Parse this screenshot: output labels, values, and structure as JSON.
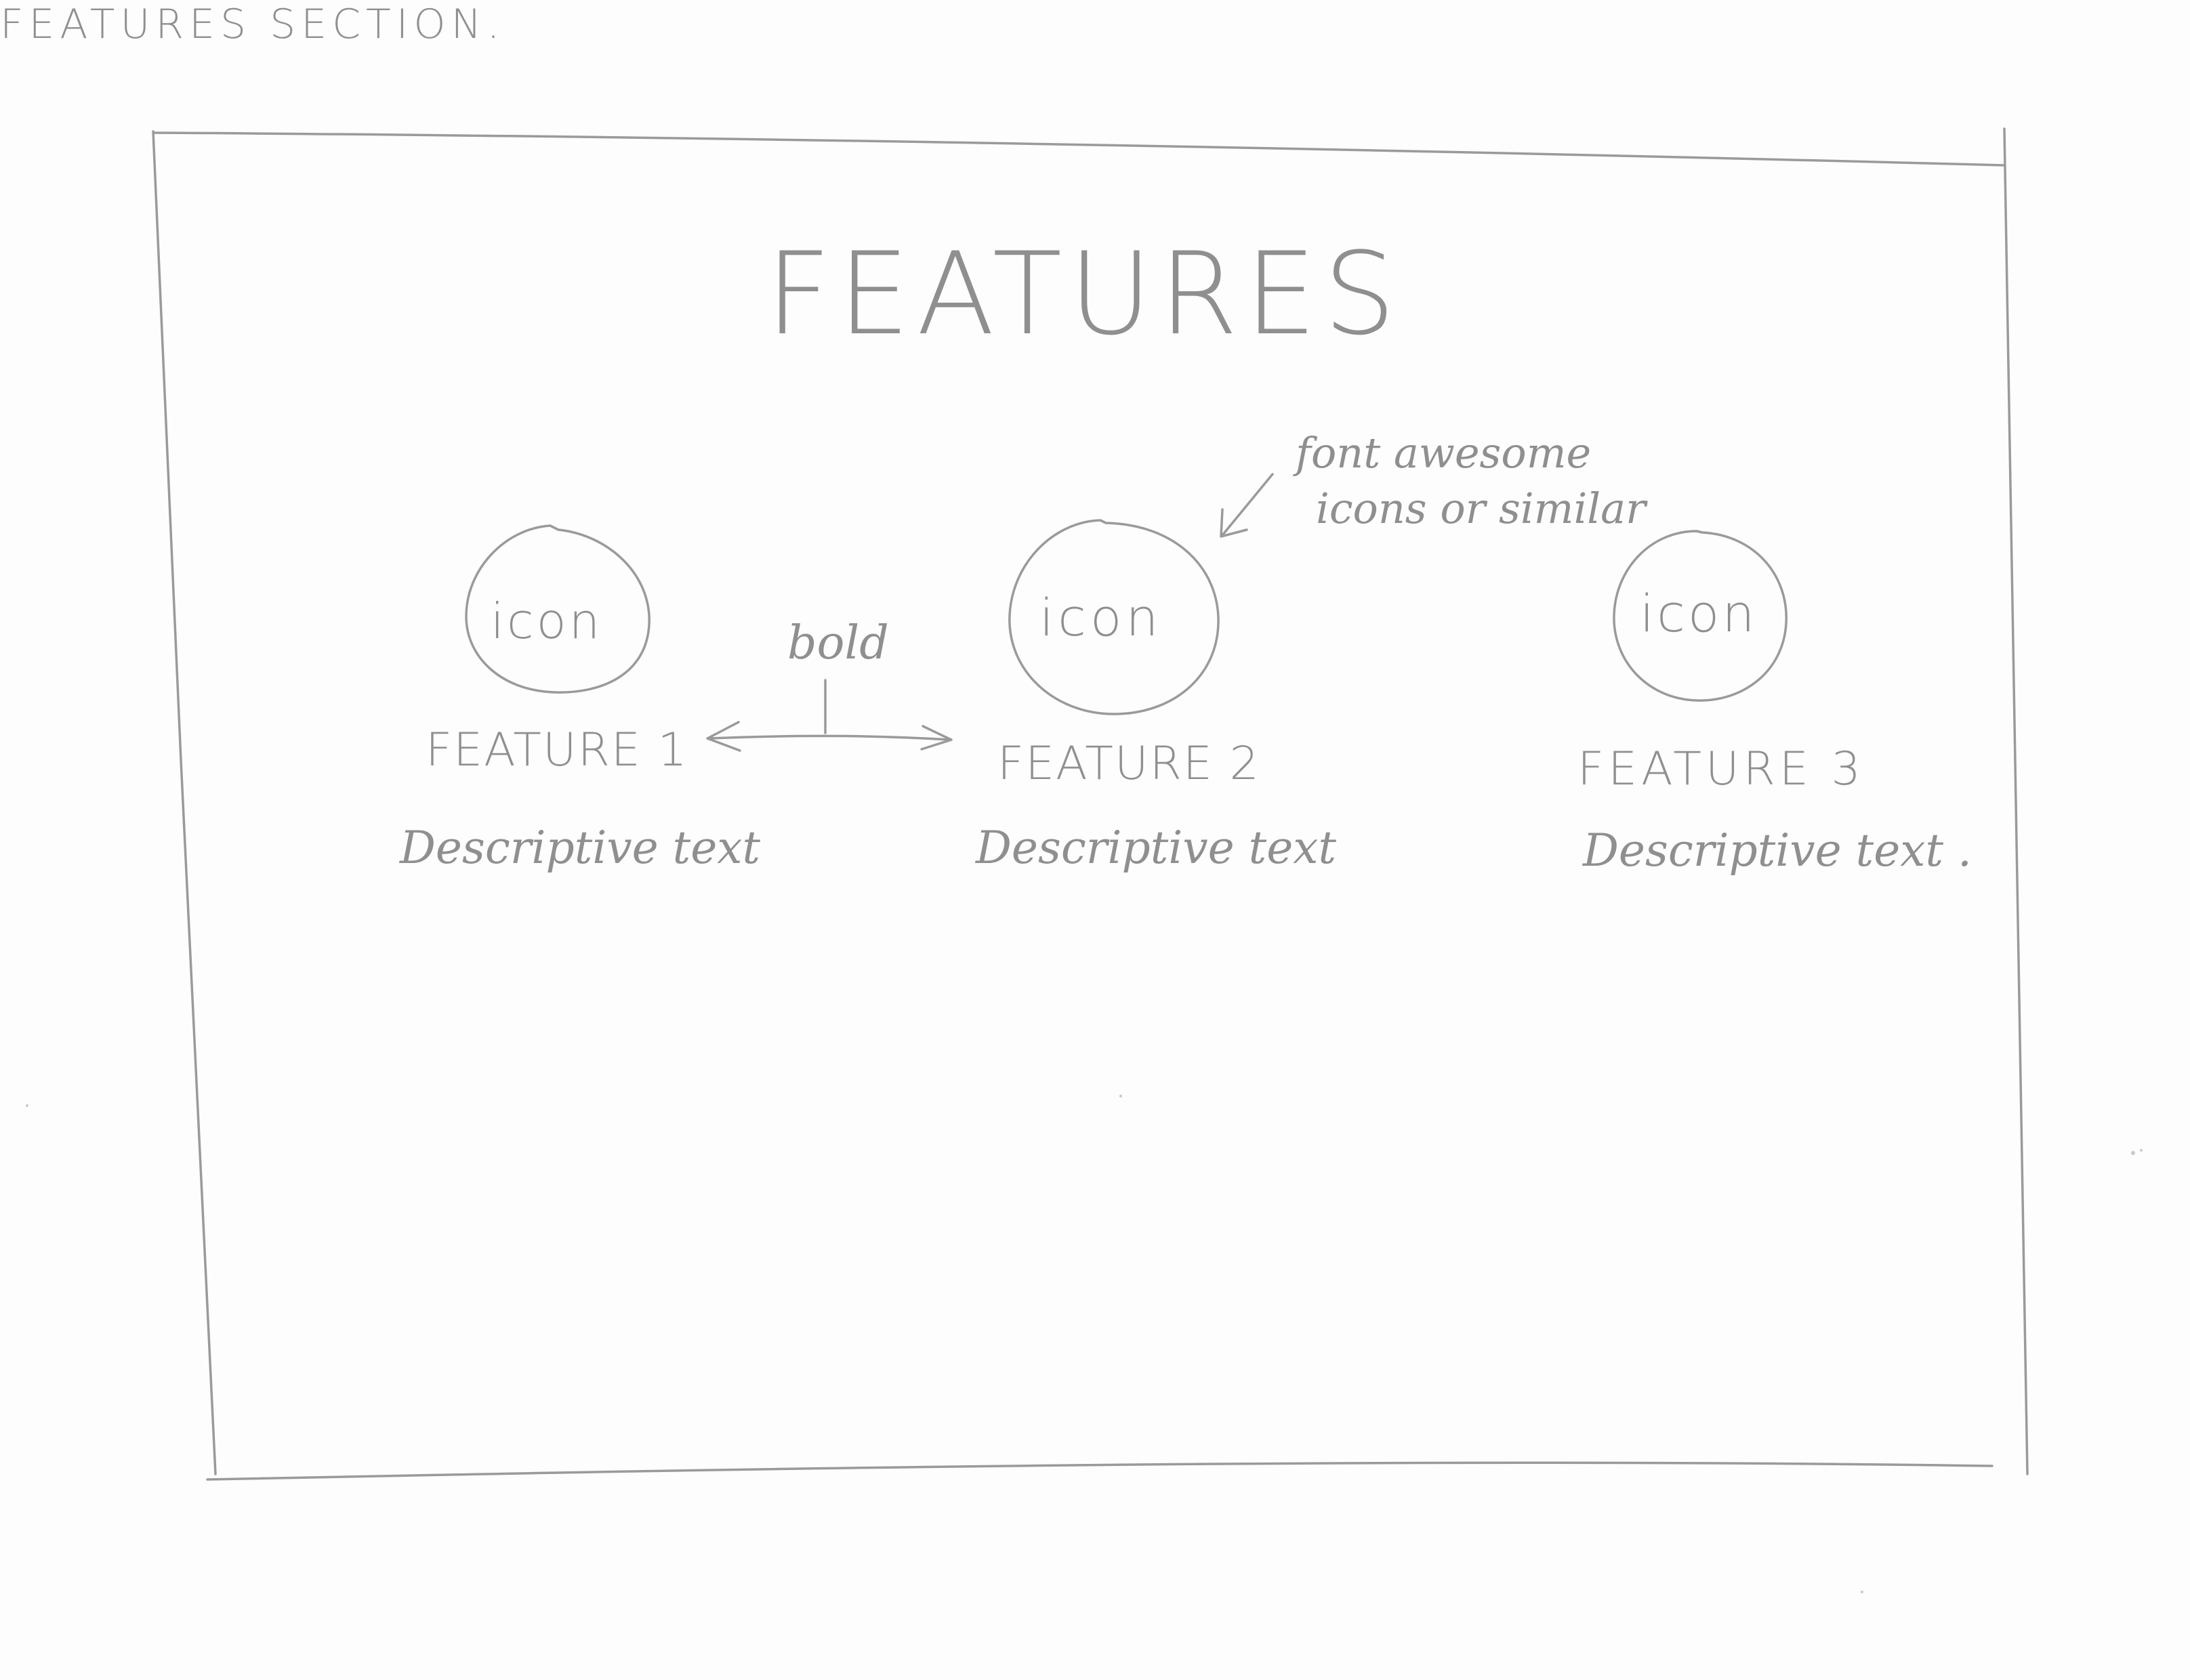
{
  "sheet_title": "FEATURES SECTION.",
  "section": {
    "heading": "FEATURES",
    "features": [
      {
        "icon_label": "icon",
        "title": "FEATURE 1",
        "description": "Descriptive text"
      },
      {
        "icon_label": "icon",
        "title": "FEATURE 2",
        "description": "Descriptive text"
      },
      {
        "icon_label": "icon",
        "title": "FEATURE 3",
        "description": "Descriptive text ."
      }
    ]
  },
  "annotations": {
    "bold_note": "bold",
    "icon_note_line1": "font awesome",
    "icon_note_line2": "icons or similar"
  },
  "colors": {
    "paper": "#fdfdfd",
    "pencil": "#9a9a9a"
  }
}
